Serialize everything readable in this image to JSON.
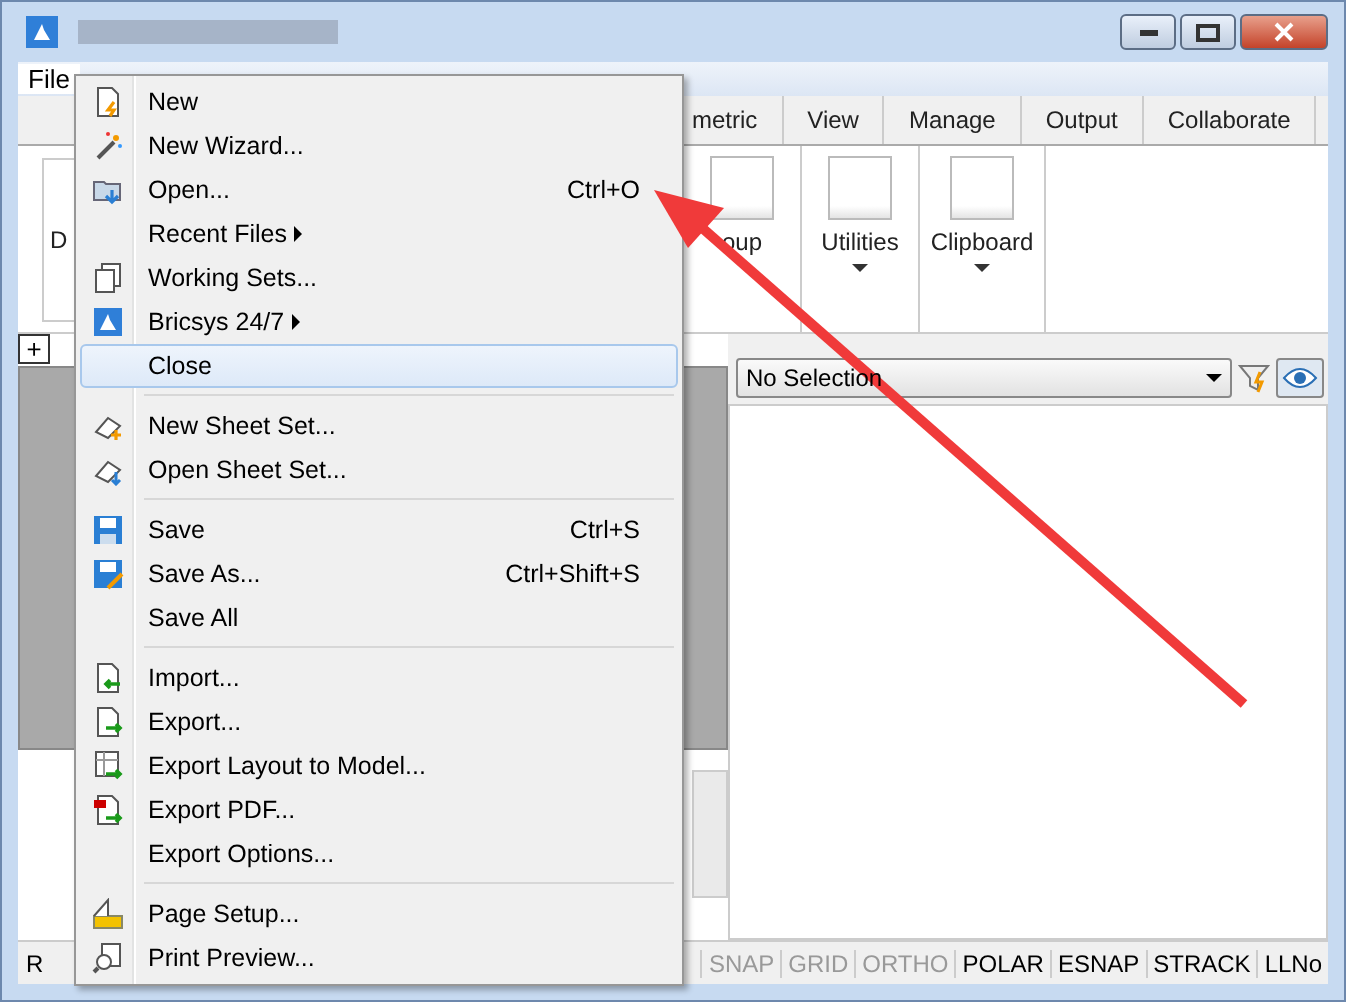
{
  "menu_bar": {
    "items": [
      {
        "label": "File",
        "selected": true
      }
    ]
  },
  "ribbon": {
    "tabs": [
      {
        "label": "metric",
        "selected": false
      },
      {
        "label": "View",
        "selected": false
      },
      {
        "label": "Manage",
        "selected": false
      },
      {
        "label": "Output",
        "selected": false
      },
      {
        "label": "Collaborate",
        "selected": false
      }
    ],
    "groups": [
      {
        "label": "oup",
        "dropdown": false
      },
      {
        "label": "Utilities",
        "dropdown": true
      },
      {
        "label": "Clipboard",
        "dropdown": true
      }
    ],
    "left_group": "D"
  },
  "drawing_tabs": {
    "add_button": "+"
  },
  "properties": {
    "selection": "No Selection"
  },
  "command_line": {
    "prompt": "R"
  },
  "status_bar": [
    {
      "label": "SNAP",
      "on": false
    },
    {
      "label": "GRID",
      "on": false
    },
    {
      "label": "ORTHO",
      "on": false
    },
    {
      "label": "POLAR",
      "on": true
    },
    {
      "label": "ESNAP",
      "on": true
    },
    {
      "label": "STRACK",
      "on": true
    },
    {
      "label": "LLNo",
      "on": true
    }
  ],
  "file_menu": [
    {
      "kind": "item",
      "label": "New",
      "submenu": false,
      "selected": false
    },
    {
      "kind": "item",
      "label": "New Wizard...",
      "submenu": false,
      "selected": false
    },
    {
      "kind": "item",
      "label": "Open...",
      "shortcut": "Ctrl+O",
      "submenu": false,
      "selected": false
    },
    {
      "kind": "item",
      "label": "Recent Files",
      "submenu": true,
      "selected": false
    },
    {
      "kind": "item",
      "label": "Working Sets...",
      "submenu": false,
      "selected": false
    },
    {
      "kind": "item",
      "label": "Bricsys 24/7",
      "submenu": true,
      "selected": false
    },
    {
      "kind": "item",
      "label": "Close",
      "submenu": false,
      "selected": true
    },
    {
      "kind": "separator"
    },
    {
      "kind": "item",
      "label": "New Sheet Set...",
      "submenu": false,
      "selected": false
    },
    {
      "kind": "item",
      "label": "Open Sheet Set...",
      "submenu": false,
      "selected": false
    },
    {
      "kind": "separator"
    },
    {
      "kind": "item",
      "label": "Save",
      "shortcut": "Ctrl+S",
      "submenu": false,
      "selected": false
    },
    {
      "kind": "item",
      "label": "Save As...",
      "shortcut": "Ctrl+Shift+S",
      "submenu": false,
      "selected": false
    },
    {
      "kind": "item",
      "label": "Save All",
      "submenu": false,
      "selected": false
    },
    {
      "kind": "separator"
    },
    {
      "kind": "item",
      "label": "Import...",
      "submenu": false,
      "selected": false
    },
    {
      "kind": "item",
      "label": "Export...",
      "submenu": false,
      "selected": false
    },
    {
      "kind": "item",
      "label": "Export Layout to Model...",
      "submenu": false,
      "selected": false
    },
    {
      "kind": "item",
      "label": "Export PDF...",
      "submenu": false,
      "selected": false
    },
    {
      "kind": "item",
      "label": "Export Options...",
      "submenu": false,
      "selected": false
    },
    {
      "kind": "separator"
    },
    {
      "kind": "item",
      "label": "Page Setup...",
      "submenu": false,
      "selected": false
    },
    {
      "kind": "item",
      "label": "Print Preview...",
      "submenu": false,
      "selected": false
    }
  ]
}
